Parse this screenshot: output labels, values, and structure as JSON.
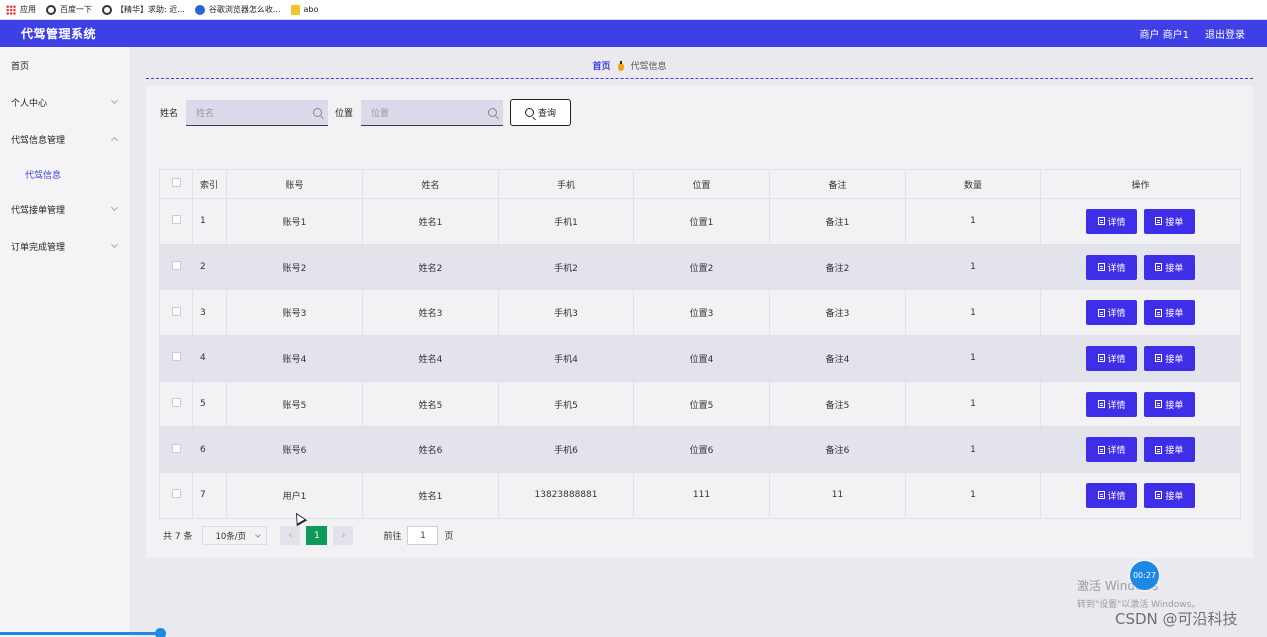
{
  "bookmarks": [
    {
      "label": "应用",
      "icon": "apps-grid-icon"
    },
    {
      "label": "百度一下",
      "icon": "globe-icon"
    },
    {
      "label": "【精华】求助: 近...",
      "icon": "globe-icon"
    },
    {
      "label": "谷歌浏览器怎么收...",
      "icon": "paw-icon"
    },
    {
      "label": "abo",
      "icon": "folder-icon"
    }
  ],
  "header": {
    "title": "代驾管理系统",
    "user": "商户 商户1",
    "logout": "退出登录",
    "accent_color": "#3f3fe6"
  },
  "sidebar": {
    "home": "首页",
    "personal_center": "个人中心",
    "driver_info_mgmt": "代驾信息管理",
    "driver_info": "代驾信息",
    "order_accept_mgmt": "代驾接单管理",
    "order_complete_mgmt": "订单完成管理"
  },
  "breadcrumb": {
    "home": "首页",
    "current": "代驾信息"
  },
  "search": {
    "name_label": "姓名",
    "name_placeholder": "姓名",
    "location_label": "位置",
    "location_placeholder": "位置",
    "query_button": "查询"
  },
  "table": {
    "headers": [
      "索引",
      "账号",
      "姓名",
      "手机",
      "位置",
      "备注",
      "数量",
      "操作"
    ],
    "rows": [
      {
        "index": "1",
        "account": "账号1",
        "name": "姓名1",
        "phone": "手机1",
        "location": "位置1",
        "note": "备注1",
        "qty": "1"
      },
      {
        "index": "2",
        "account": "账号2",
        "name": "姓名2",
        "phone": "手机2",
        "location": "位置2",
        "note": "备注2",
        "qty": "1"
      },
      {
        "index": "3",
        "account": "账号3",
        "name": "姓名3",
        "phone": "手机3",
        "location": "位置3",
        "note": "备注3",
        "qty": "1"
      },
      {
        "index": "4",
        "account": "账号4",
        "name": "姓名4",
        "phone": "手机4",
        "location": "位置4",
        "note": "备注4",
        "qty": "1"
      },
      {
        "index": "5",
        "account": "账号5",
        "name": "姓名5",
        "phone": "手机5",
        "location": "位置5",
        "note": "备注5",
        "qty": "1"
      },
      {
        "index": "6",
        "account": "账号6",
        "name": "姓名6",
        "phone": "手机6",
        "location": "位置6",
        "note": "备注6",
        "qty": "1"
      },
      {
        "index": "7",
        "account": "用户1",
        "name": "姓名1",
        "phone": "13823888881",
        "location": "111",
        "note": "11",
        "qty": "1"
      }
    ],
    "detail_button": "详情",
    "accept_button": "接单",
    "button_color": "#3f2ee8"
  },
  "pagination": {
    "total": "共 7 条",
    "page_size": "10条/页",
    "current_page": "1",
    "goto_label": "前往",
    "goto_value": "1",
    "page_suffix": "页",
    "active_color": "#0e9a5a"
  },
  "overlay": {
    "windows_activate": "激活 Windows",
    "windows_activate_sub": "转到\"设置\"以激活 Windows。",
    "timer": "00:27",
    "watermark": "CSDN @可沿科技"
  }
}
